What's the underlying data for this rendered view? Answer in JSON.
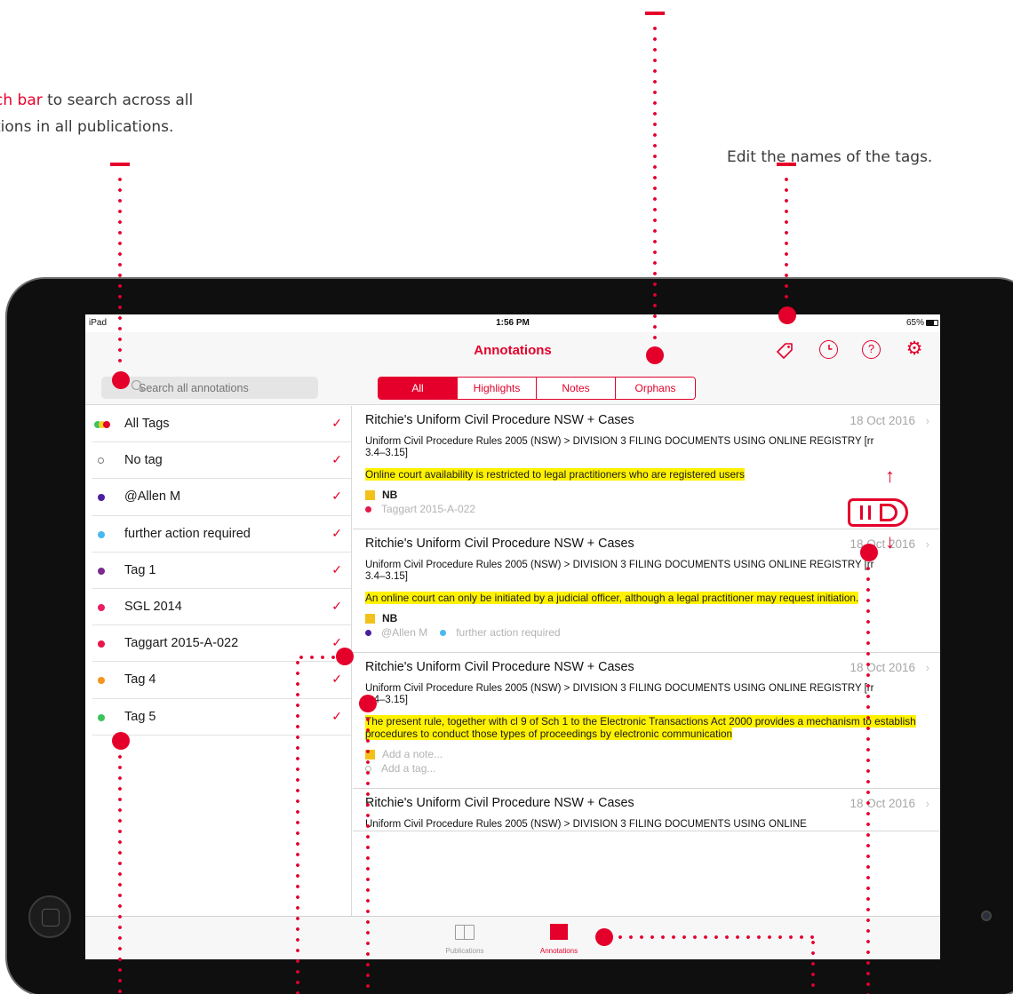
{
  "captions": {
    "search": {
      "highlight": "ch bar",
      "rest": " to search across all",
      "line2": "tions in all publications."
    },
    "tags": "Edit the names of the tags."
  },
  "status_bar": {
    "carrier": "iPad",
    "time": "1:56 PM",
    "battery": "65%"
  },
  "nav": {
    "title": "Annotations"
  },
  "search": {
    "placeholder": "Search all annotations"
  },
  "segments": [
    {
      "label": "All",
      "active": true
    },
    {
      "label": "Highlights",
      "active": false
    },
    {
      "label": "Notes",
      "active": false
    },
    {
      "label": "Orphans",
      "active": false
    }
  ],
  "tags": [
    {
      "label": "All Tags",
      "color": "multi",
      "checked": true
    },
    {
      "label": "No tag",
      "color": "none",
      "checked": true
    },
    {
      "label": "@Allen M",
      "color": "#4b1fa0",
      "checked": true
    },
    {
      "label": "further action required",
      "color": "#4ab8f0",
      "checked": true
    },
    {
      "label": "Tag 1",
      "color": "#7b2a8f",
      "checked": true
    },
    {
      "label": "SGL 2014",
      "color": "#e91e63",
      "checked": true
    },
    {
      "label": "Taggart 2015-A-022",
      "color": "#e6174a",
      "checked": true
    },
    {
      "label": "Tag 4",
      "color": "#f7931e",
      "checked": true
    },
    {
      "label": "Tag 5",
      "color": "#3cc45a",
      "checked": true
    }
  ],
  "annotations": [
    {
      "title": "Ritchie's Uniform Civil Procedure NSW + Cases",
      "date": "18 Oct 2016",
      "path": "Uniform Civil Procedure Rules 2005 (NSW) > DIVISION 3 FILING DOCUMENTS USING ONLINE REGISTRY [rr 3.4–3.15]",
      "highlight": "Online court availability is restricted to legal practitioners who are registered users",
      "note": "NB",
      "tags": [
        {
          "label": "Taggart 2015-A-022",
          "color": "#e6174a"
        }
      ]
    },
    {
      "title": "Ritchie's Uniform Civil Procedure NSW + Cases",
      "date": "18 Oct 2016",
      "path": "Uniform Civil Procedure Rules 2005 (NSW) > DIVISION 3 FILING DOCUMENTS USING ONLINE REGISTRY [rr 3.4–3.15]",
      "highlight": "An online court can only be initiated by a judicial officer, although a legal practitioner may request initiation.",
      "note": "NB",
      "tags": [
        {
          "label": "@Allen M",
          "color": "#4b1fa0"
        },
        {
          "label": "further action required",
          "color": "#4ab8f0"
        }
      ]
    },
    {
      "title": "Ritchie's Uniform Civil Procedure NSW + Cases",
      "date": "18 Oct 2016",
      "path": "Uniform Civil Procedure Rules 2005 (NSW) > DIVISION 3 FILING DOCUMENTS USING ONLINE REGISTRY [rr 3.4–3.15]",
      "highlight": "The present rule, together with cl 9 of Sch 1 to the Electronic Transactions Act 2000 provides a mechanism to establish procedures to conduct those types of proceedings by electronic communication",
      "note_placeholder": "Add a note...",
      "tag_placeholder": "Add a tag..."
    },
    {
      "title": "Ritchie's Uniform Civil Procedure NSW + Cases",
      "date": "18 Oct 2016",
      "path": "Uniform Civil Procedure Rules 2005 (NSW) > DIVISION 3 FILING DOCUMENTS USING ONLINE"
    }
  ],
  "tabbar": {
    "publications": "Publications",
    "annotations": "Annotations"
  },
  "colors": {
    "accent": "#e4002b",
    "highlight": "#fff200"
  }
}
